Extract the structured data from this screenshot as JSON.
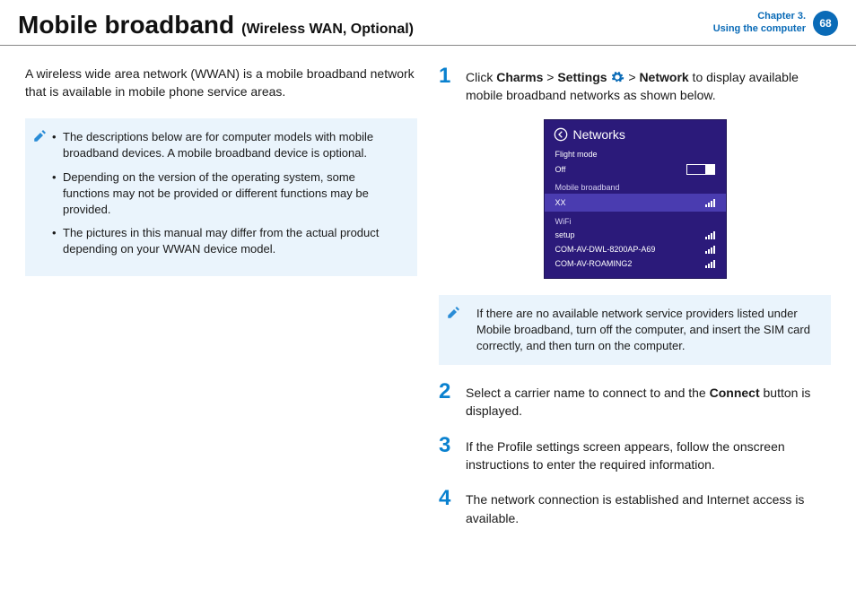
{
  "header": {
    "title_main": "Mobile broadband",
    "title_sub": "(Wireless WAN, Optional)",
    "chapter_line1": "Chapter 3.",
    "chapter_line2": "Using the computer",
    "page_number": "68"
  },
  "left": {
    "intro": "A wireless wide area network (WWAN) is a mobile broadband network that is available in mobile phone service areas.",
    "notes": [
      "The descriptions below are for computer models with mobile broadband devices. A mobile broadband device is optional.",
      "Depending on the version of the operating system, some functions may not be provided or different functions may be provided.",
      "The pictures in this manual may differ from the actual product depending on your WWAN device model."
    ]
  },
  "right": {
    "step1_pre": "Click ",
    "step1_b1": "Charms",
    "step1_gt1": " > ",
    "step1_b2": "Settings",
    "step1_gt2": " > ",
    "step1_b3": "Network",
    "step1_post": " to display available mobile broadband networks as shown below.",
    "panel": {
      "title": "Networks",
      "flight_label": "Flight mode",
      "flight_value": "Off",
      "mb_section": "Mobile broadband",
      "mb_item": "XX",
      "wifi_section": "WiFi",
      "wifi_items": [
        "setup",
        "COM-AV-DWL-8200AP-A69",
        "COM-AV-ROAMING2"
      ]
    },
    "note2": "If there are no available network service providers listed under Mobile broadband, turn off the computer, and insert the SIM card correctly, and then turn on the computer.",
    "step2_pre": "Select a carrier name to connect to and the ",
    "step2_b": "Connect",
    "step2_post": " button is displayed.",
    "step3": "If the Profile settings screen appears, follow the onscreen instructions to enter the required information.",
    "step4": "The network connection is established and Internet access is available."
  },
  "numbers": {
    "n1": "1",
    "n2": "2",
    "n3": "3",
    "n4": "4"
  }
}
